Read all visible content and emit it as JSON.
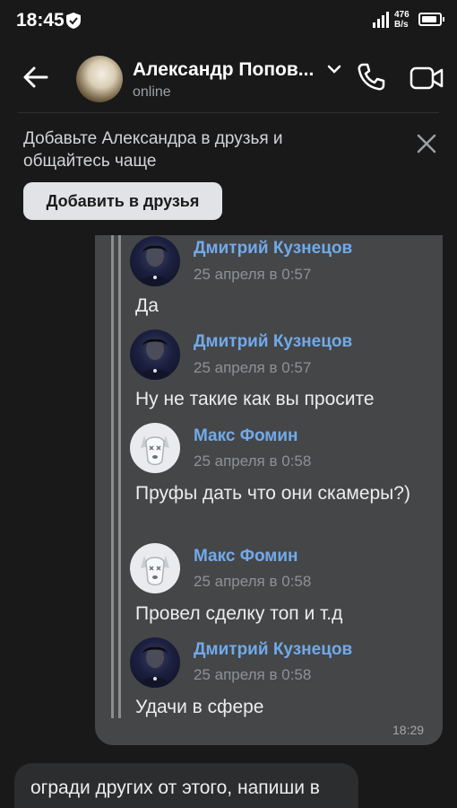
{
  "status_bar": {
    "time": "18:45",
    "signal": "4G",
    "net_speed": "476",
    "net_unit": "B/s"
  },
  "header": {
    "name": "Александр Попов...",
    "status": "online"
  },
  "banner": {
    "text": "Добавьте Александра в друзья и общайтесь чаще",
    "button": "Добавить в друзья"
  },
  "message": {
    "forwarded": [
      {
        "author": "Дмитрий Кузнецов",
        "date": "25 апреля в 0:57",
        "text": "Да"
      },
      {
        "author": "Дмитрий Кузнецов",
        "date": "25 апреля в 0:57",
        "text": "Ну не такие как вы просите"
      },
      {
        "author": "Макс Фомин",
        "date": "25 апреля в 0:58",
        "text": "Пруфы дать что они скамеры?)"
      },
      {
        "author": "Макс Фомин",
        "date": "25 апреля в 0:58",
        "text": "Провел сделку топ и т.д"
      },
      {
        "author": "Дмитрий Кузнецов",
        "date": "25 апреля в 0:58",
        "text": "Удачи в сфере"
      }
    ],
    "time": "18:29"
  },
  "incoming": {
    "text": "огради других от этого, напиши в"
  },
  "colors": {
    "background": "#19191a",
    "bubble": "#454647",
    "link": "#71aaeb"
  }
}
